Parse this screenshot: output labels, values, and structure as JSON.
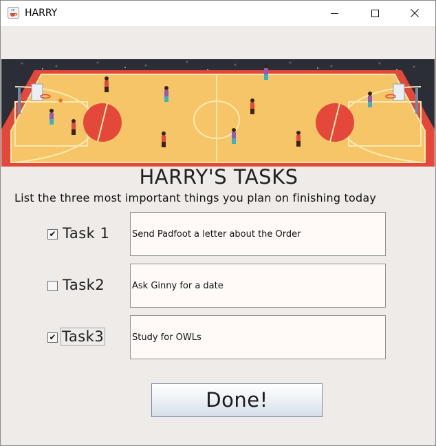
{
  "window": {
    "title": "HARRY"
  },
  "icons": {
    "app": "java-cup-icon",
    "minimize": "minimize-icon",
    "maximize": "maximize-icon",
    "close": "close-icon"
  },
  "header": {
    "title": "HARRY'S TASKS",
    "subtitle": "List the three most important things you plan on finishing today"
  },
  "tasks": [
    {
      "label": "Task 1",
      "checked": true,
      "value": "Send Padfoot a letter about the Order"
    },
    {
      "label": "Task2",
      "checked": false,
      "value": "Ask Ginny for a date"
    },
    {
      "label": "Task3",
      "checked": true,
      "value": "Study for OWLs"
    }
  ],
  "done_button": {
    "label": "Done!"
  },
  "colors": {
    "court_floor": "#f6c567",
    "court_border": "#e44b3a",
    "background": "#efebe8"
  }
}
